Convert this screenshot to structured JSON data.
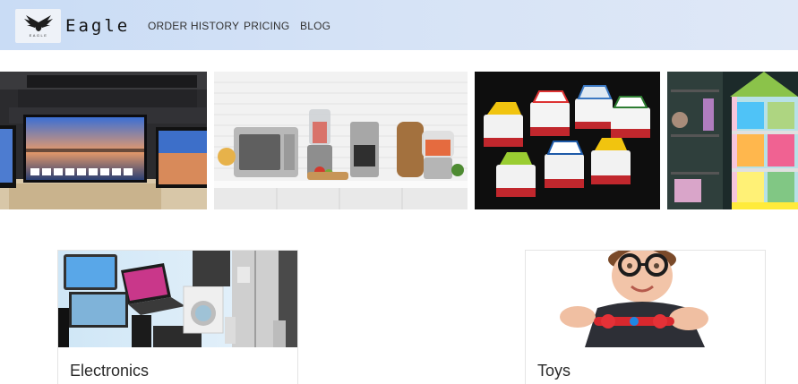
{
  "brand": {
    "name": "Eagle",
    "logo": "eagle-logo",
    "logo_caption": "EAGLE"
  },
  "nav": {
    "links": [
      {
        "label": "ORDER HISTORY"
      },
      {
        "label": "PRICING"
      },
      {
        "label": "BLOG"
      }
    ]
  },
  "banner": {
    "tiles": [
      {
        "image": "televisions-showroom-photo"
      },
      {
        "image": "kitchen-appliances-photo"
      },
      {
        "image": "toy-cars-photo"
      },
      {
        "image": "dollhouse-toys-photo"
      }
    ]
  },
  "categories": [
    {
      "title": "Electronics",
      "image": "electronics-collage-photo"
    },
    {
      "title": "Toys",
      "image": "boy-with-fidget-spinner-photo"
    }
  ],
  "colors": {
    "navbar": "#d6e3f6",
    "text": "#333333"
  }
}
